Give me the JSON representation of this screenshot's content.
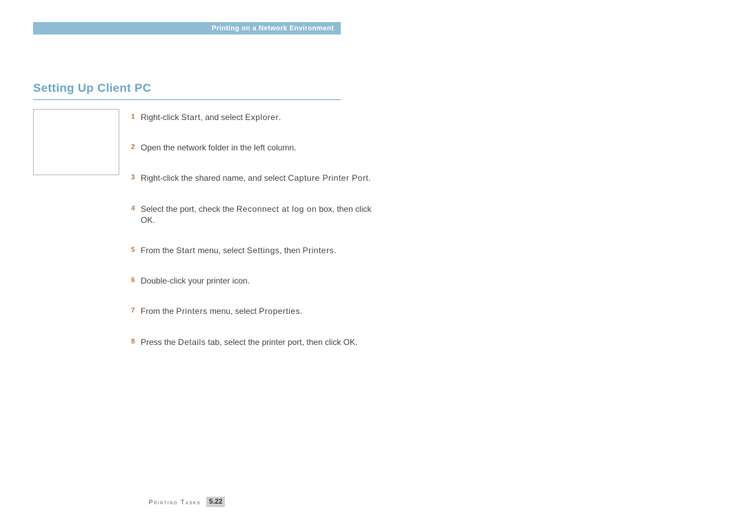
{
  "header": {
    "title": "Printing on a Network Environment"
  },
  "section_title": "Setting Up Client PC",
  "steps": [
    {
      "n": "1",
      "parts": [
        {
          "t": "Right-click ",
          "cmd": false
        },
        {
          "t": "Start",
          "cmd": true
        },
        {
          "t": ", and select ",
          "cmd": false
        },
        {
          "t": "Explorer",
          "cmd": true
        },
        {
          "t": ".",
          "cmd": false
        }
      ]
    },
    {
      "n": "2",
      "parts": [
        {
          "t": "Open the network folder in the left column.",
          "cmd": false
        }
      ]
    },
    {
      "n": "3",
      "parts": [
        {
          "t": "Right-click the shared name, and select ",
          "cmd": false
        },
        {
          "t": "Capture Printer Port",
          "cmd": true
        },
        {
          "t": ".",
          "cmd": false
        }
      ]
    },
    {
      "n": "4",
      "parts": [
        {
          "t": "Select the port, check the ",
          "cmd": false
        },
        {
          "t": "Reconnect at log on",
          "cmd": true
        },
        {
          "t": " box, then click OK.",
          "cmd": false
        }
      ]
    },
    {
      "n": "5",
      "parts": [
        {
          "t": "From the ",
          "cmd": false
        },
        {
          "t": "Start",
          "cmd": true
        },
        {
          "t": " menu, select ",
          "cmd": false
        },
        {
          "t": "Settings",
          "cmd": true
        },
        {
          "t": ", then ",
          "cmd": false
        },
        {
          "t": "Printers",
          "cmd": true
        },
        {
          "t": ".",
          "cmd": false
        }
      ]
    },
    {
      "n": "6",
      "parts": [
        {
          "t": "Double-click your printer icon.",
          "cmd": false
        }
      ]
    },
    {
      "n": "7",
      "parts": [
        {
          "t": "From the ",
          "cmd": false
        },
        {
          "t": "Printers",
          "cmd": true
        },
        {
          "t": " menu, select ",
          "cmd": false
        },
        {
          "t": "Properties",
          "cmd": true
        },
        {
          "t": ".",
          "cmd": false
        }
      ]
    },
    {
      "n": "8",
      "parts": [
        {
          "t": "Press the ",
          "cmd": false
        },
        {
          "t": "Details",
          "cmd": true
        },
        {
          "t": " tab, select the printer port, then click OK.",
          "cmd": false
        }
      ]
    }
  ],
  "footer": {
    "label": "Printing Tasks",
    "page": "5.22"
  }
}
